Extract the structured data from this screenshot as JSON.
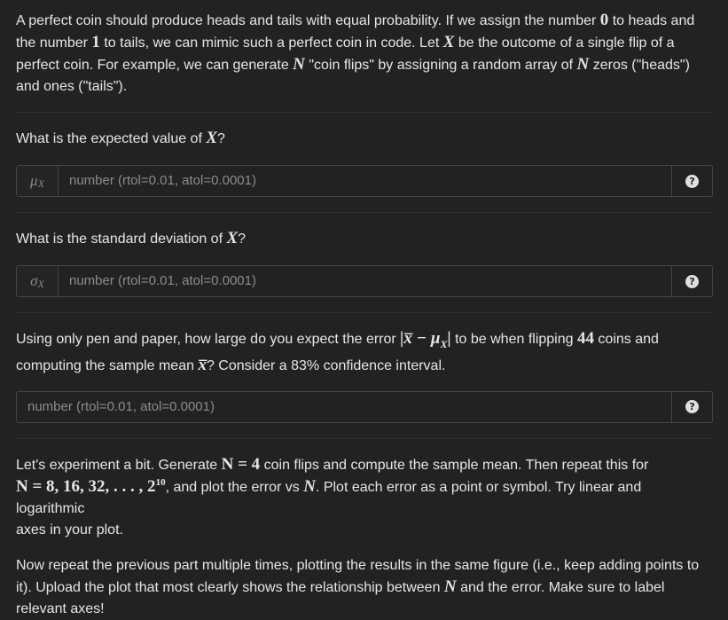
{
  "intro": {
    "t1": "A perfect coin should produce heads and tails with equal probability. If we assign the number ",
    "n0": "0",
    "t2": " to heads and",
    "t3": "the number ",
    "n1": "1",
    "t4": " to tails, we can mimic such a perfect coin in code. Let ",
    "var_x": "X",
    "t5": " be the outcome of a single flip of a",
    "t6": "perfect coin. For example, we can generate ",
    "var_n": "N",
    "t7": " \"coin flips\" by assigning a random array of ",
    "t8": " zeros (\"heads\")",
    "t9": "and ones (\"tails\")."
  },
  "q1": {
    "text": "What is the expected value of ",
    "var": "X",
    "end": "?",
    "prefix": "μ",
    "prefix_sub": "X",
    "placeholder": "number (rtol=0.01, atol=0.0001)",
    "help_icon": "?"
  },
  "q2": {
    "text": "What is the standard deviation of ",
    "var": "X",
    "end": "?",
    "prefix": "σ",
    "prefix_sub": "X",
    "placeholder": "number (rtol=0.01, atol=0.0001)",
    "help_icon": "?"
  },
  "q3": {
    "t1": "Using only pen and paper, how large do you expect the error ",
    "expr": "|x̅ − μ",
    "expr_sub": "X",
    "expr_end": "|",
    "t2": " to be when flipping ",
    "coins": "44",
    "t3": " coins and",
    "t4": "computing the sample mean ",
    "xbar": "x̅",
    "t5": "? Consider a 83% confidence interval.",
    "placeholder": "number (rtol=0.01, atol=0.0001)",
    "help_icon": "?"
  },
  "p4": {
    "t1": "Let's experiment a bit. Generate ",
    "eq1": "N = 4",
    "t2": " coin flips and compute the sample mean. Then repeat this for",
    "eq2": "N = 8, 16, 32, . . . , 2",
    "eq2_sup": "10",
    "t3": ", and plot the error vs ",
    "var_n": "N",
    "t4": ". Plot each error as a point or symbol. Try linear and logarithmic",
    "t5": "axes in your plot."
  },
  "p5": {
    "t1": "Now repeat the previous part multiple times, plotting the results in the same figure (i.e., keep adding points to",
    "t2": "it). Upload the plot that most clearly shows the relationship between ",
    "var_n": "N",
    "t3": " and the error. Make sure to label",
    "t4": "relevant axes!"
  }
}
